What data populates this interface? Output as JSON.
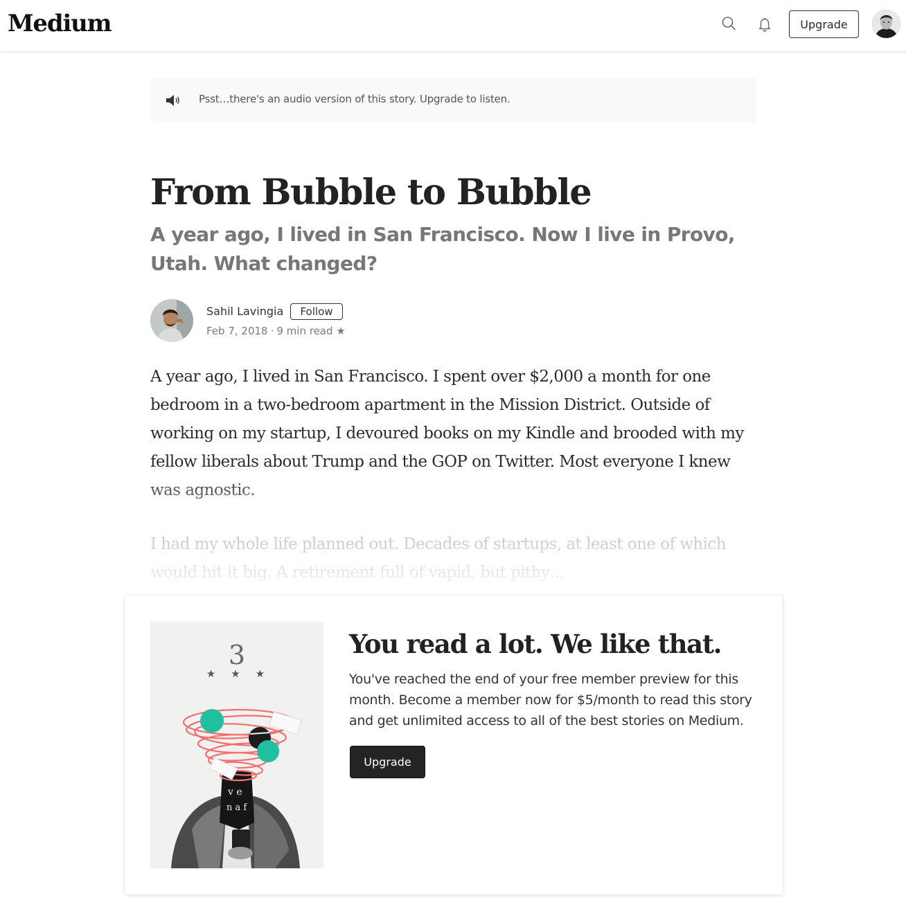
{
  "header": {
    "logo": "Medium",
    "upgrade_label": "Upgrade",
    "icons": [
      "search-icon",
      "bell-icon"
    ]
  },
  "audio_banner": {
    "text": "Psst…there's an audio version of this story. Upgrade to listen.",
    "icon": "speaker-icon"
  },
  "article": {
    "title": "From Bubble to Bubble",
    "subtitle": "A year ago, I lived in San Francisco. Now I live in Provo, Utah. What changed?",
    "author": {
      "name": "Sahil Lavingia",
      "follow_label": "Follow",
      "date": "Feb 7, 2018",
      "read_time": "9 min read",
      "star": "★"
    },
    "paragraphs": [
      "A year ago, I lived in San Francisco. I spent over $2,000 a month for one bedroom in a two-bedroom apartment in the Mission District. Outside of working on my startup, I devoured books on my Kindle and brooded with my fellow liberals about Trump and the GOP on Twitter. Most everyone I knew was agnostic.",
      "I had my whole life planned out. Decades of startups, at least one of which would hit it big. A retirement full of vapid, but pithy…"
    ]
  },
  "paywall": {
    "art_number": "3",
    "art_stars": "★★★",
    "heading": "You read a lot. We like that.",
    "text": "You've reached the end of your free member preview for this month. Become a member now for $5/month to read this story and get unlimited access to all of the best stories on Medium.",
    "upgrade_label": "Upgrade"
  },
  "colors": {
    "accent_teal": "#1fbf9f",
    "swirl_red": "#f0706f",
    "dark_button": "#242424"
  }
}
